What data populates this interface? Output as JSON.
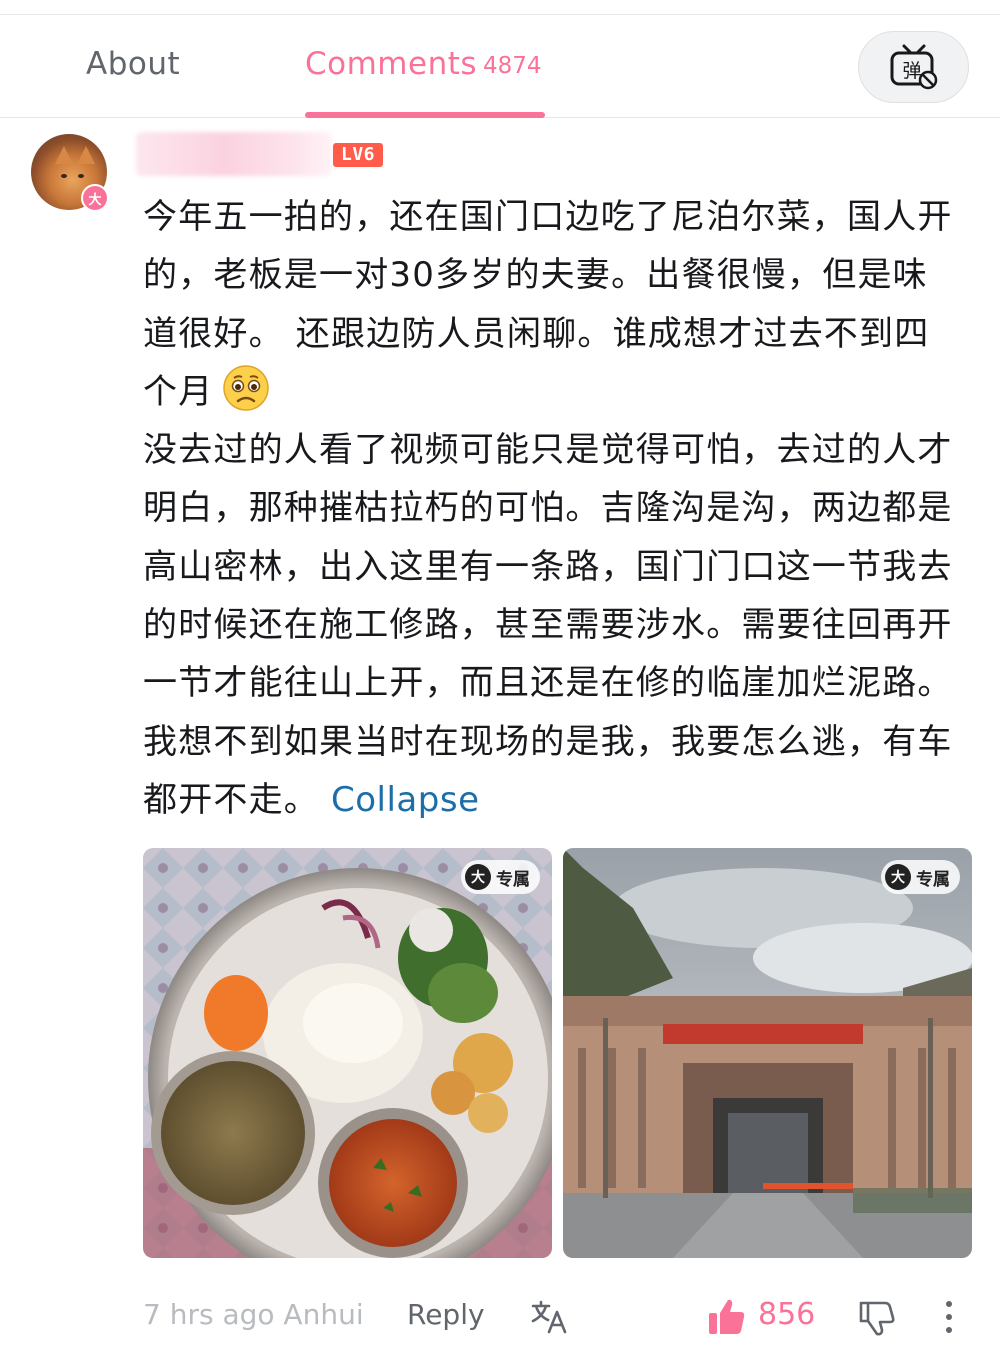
{
  "tabs": {
    "about_label": "About",
    "comments_label": "Comments",
    "comments_count": "4874",
    "active_color": "#fb7299",
    "danmaku_icon": "danmaku-off-icon",
    "danmaku_glyph": "弹"
  },
  "comment": {
    "vip_badge": "大",
    "level": "LV6",
    "paragraph_1": "今年五一拍的，还在国门口边吃了尼泊尔菜，国人开的，老板是一对30多岁的夫妻。出餐很慢，但是味道很好。 还跟边防人员闲聊。谁成想才过去不到四个月",
    "emoji": "worried-face-emoji",
    "paragraph_2": "没去过的人看了视频可能只是觉得可怕，去过的人才明白，那种摧枯拉朽的可怕。吉隆沟是沟，两边都是高山密林，出入这里有一条路，国门门口这一节我去的时候还在施工修路，甚至需要涉水。需要往回再开一节才能往山上开，而且还是在修的临崖加烂泥路。我想不到如果当时在现场的是我，我要怎么逃，有车都开不走。",
    "collapse_label": "Collapse",
    "images": [
      {
        "tag_icon": "大",
        "tag_label": "专属"
      },
      {
        "tag_icon": "大",
        "tag_label": "专属"
      }
    ],
    "footer": {
      "time_location": "7 hrs ago Anhui",
      "reply_label": "Reply",
      "like_count": "856"
    }
  }
}
